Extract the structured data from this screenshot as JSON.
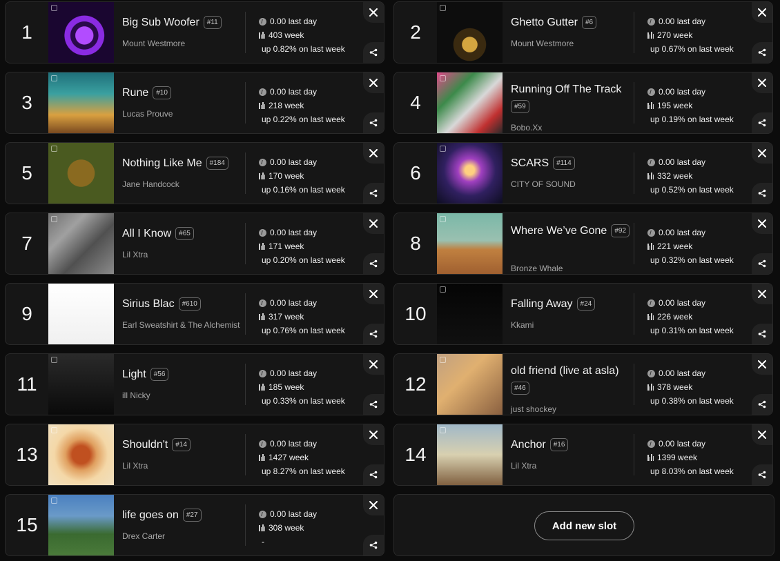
{
  "tracks": [
    {
      "rank": "1",
      "title": "Big Sub Woofer",
      "position": "#11",
      "artist": "Mount Westmore",
      "last_day": "0.00 last day",
      "week": "403 week",
      "growth": "up 0.82% on last week"
    },
    {
      "rank": "2",
      "title": "Ghetto Gutter",
      "position": "#6",
      "artist": "Mount Westmore",
      "last_day": "0.00 last day",
      "week": "270 week",
      "growth": "up 0.67% on last week"
    },
    {
      "rank": "3",
      "title": "Rune",
      "position": "#10",
      "artist": "Lucas Prouve",
      "last_day": "0.00 last day",
      "week": "218 week",
      "growth": "up 0.22% on last week"
    },
    {
      "rank": "4",
      "title": "Running Off The Track",
      "position": "#59",
      "artist": "Bobo.Xx",
      "last_day": "0.00 last day",
      "week": "195 week",
      "growth": "up 0.19% on last week"
    },
    {
      "rank": "5",
      "title": "Nothing Like Me",
      "position": "#184",
      "artist": "Jane Handcock",
      "last_day": "0.00 last day",
      "week": "170 week",
      "growth": "up 0.16% on last week"
    },
    {
      "rank": "6",
      "title": "SCARS",
      "position": "#114",
      "artist": "CITY OF SOUND",
      "last_day": "0.00 last day",
      "week": "332 week",
      "growth": "up 0.52% on last week"
    },
    {
      "rank": "7",
      "title": "All I Know",
      "position": "#65",
      "artist": "Lil Xtra",
      "last_day": "0.00 last day",
      "week": "171 week",
      "growth": "up 0.20% on last week"
    },
    {
      "rank": "8",
      "title": "Where We’ve Gone",
      "position": "#92",
      "artist": "Bronze Whale",
      "last_day": "0.00 last day",
      "week": "221 week",
      "growth": "up 0.32% on last week"
    },
    {
      "rank": "9",
      "title": "Sirius Blac",
      "position": "#610",
      "artist": "Earl Sweatshirt & The Alchemist",
      "last_day": "0.00 last day",
      "week": "317 week",
      "growth": "up 0.76% on last week"
    },
    {
      "rank": "10",
      "title": "Falling Away",
      "position": "#24",
      "artist": "Kkami",
      "last_day": "0.00 last day",
      "week": "226 week",
      "growth": "up 0.31% on last week"
    },
    {
      "rank": "11",
      "title": "Light",
      "position": "#56",
      "artist": "ill Nicky",
      "last_day": "0.00 last day",
      "week": "185 week",
      "growth": "up 0.33% on last week"
    },
    {
      "rank": "12",
      "title": "old friend (live at asla)",
      "position": "#46",
      "artist": "just shockey",
      "last_day": "0.00 last day",
      "week": "378 week",
      "growth": "up 0.38% on last week"
    },
    {
      "rank": "13",
      "title": "Shouldn't",
      "position": "#14",
      "artist": "Lil Xtra",
      "last_day": "0.00 last day",
      "week": "1427 week",
      "growth": "up 8.27% on last week"
    },
    {
      "rank": "14",
      "title": "Anchor",
      "position": "#16",
      "artist": "Lil Xtra",
      "last_day": "0.00 last day",
      "week": "1399 week",
      "growth": "up 8.03% on last week"
    },
    {
      "rank": "15",
      "title": "life goes on",
      "position": "#27",
      "artist": "Drex Carter",
      "last_day": "0.00 last day",
      "week": "308 week",
      "growth": "-"
    }
  ],
  "add_slot_label": "Add new slot",
  "icons": {
    "close": "close-icon",
    "share": "share-icon",
    "coin": "coin-icon",
    "bars": "bars-icon"
  },
  "colors": {
    "background": "#0c0c0c",
    "card": "#161616",
    "text_muted": "#a6a6a6"
  }
}
